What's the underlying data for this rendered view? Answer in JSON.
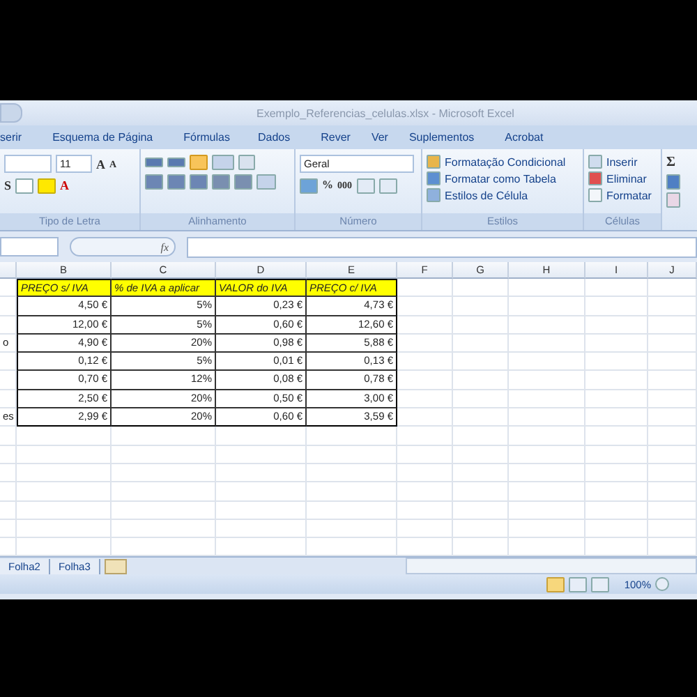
{
  "window": {
    "title": "Exemplo_Referencias_celulas.xlsx - Microsoft Excel"
  },
  "tabs": [
    {
      "label": "serir",
      "selected": false
    },
    {
      "label": "Esquema de Página",
      "selected": false
    },
    {
      "label": "Fórmulas",
      "selected": false
    },
    {
      "label": "Dados",
      "selected": false
    },
    {
      "label": "Rever",
      "selected": false
    },
    {
      "label": "Ver",
      "selected": false
    },
    {
      "label": "Suplementos",
      "selected": false
    },
    {
      "label": "Acrobat",
      "selected": false
    }
  ],
  "ribbon": {
    "font": {
      "size": "11",
      "grow": "A",
      "shrink": "A",
      "underline": "S",
      "color_button": "A",
      "label": "Tipo de Letra"
    },
    "alignment": {
      "label": "Alinhamento"
    },
    "number": {
      "format": "Geral",
      "percent": "%",
      "thousands": "000",
      "label": "Número"
    },
    "styles": {
      "items": [
        "Formatação Condicional",
        "Formatar como Tabela",
        "Estilos de Célula"
      ],
      "label": "Estilos"
    },
    "cells": {
      "items": [
        "Inserir",
        "Eliminar",
        "Formatar"
      ],
      "label": "Células"
    },
    "editing": {
      "sum": "Σ"
    }
  },
  "formula_bar": {
    "fx": "fx"
  },
  "columns": [
    "",
    "B",
    "C",
    "D",
    "E",
    "F",
    "G",
    "H",
    "I",
    "J"
  ],
  "rows": [
    {
      "kind": "header",
      "cells": [
        "",
        "PREÇO s/ IVA",
        "% de IVA a aplicar",
        "VALOR do IVA",
        "PREÇO c/ IVA"
      ]
    },
    {
      "kind": "data",
      "cells": [
        "",
        "4,50 €",
        "5%",
        "0,23 €",
        "4,73 €"
      ]
    },
    {
      "kind": "data",
      "cells": [
        "",
        "12,00 €",
        "5%",
        "0,60 €",
        "12,60 €"
      ]
    },
    {
      "kind": "data",
      "cells": [
        "o",
        "4,90 €",
        "20%",
        "0,98 €",
        "5,88 €"
      ]
    },
    {
      "kind": "data",
      "cells": [
        "",
        "0,12 €",
        "5%",
        "0,01 €",
        "0,13 €"
      ]
    },
    {
      "kind": "data",
      "cells": [
        "",
        "0,70 €",
        "12%",
        "0,08 €",
        "0,78 €"
      ]
    },
    {
      "kind": "data",
      "cells": [
        "",
        "2,50 €",
        "20%",
        "0,50 €",
        "3,00 €"
      ]
    },
    {
      "kind": "data",
      "cells": [
        "es",
        "2,99 €",
        "20%",
        "0,60 €",
        "3,59 €"
      ]
    }
  ],
  "sheet_tabs": [
    {
      "label": "Folha2",
      "selected": false
    },
    {
      "label": "Folha3",
      "selected": false
    }
  ],
  "status_bar": {
    "zoom": "100%"
  }
}
